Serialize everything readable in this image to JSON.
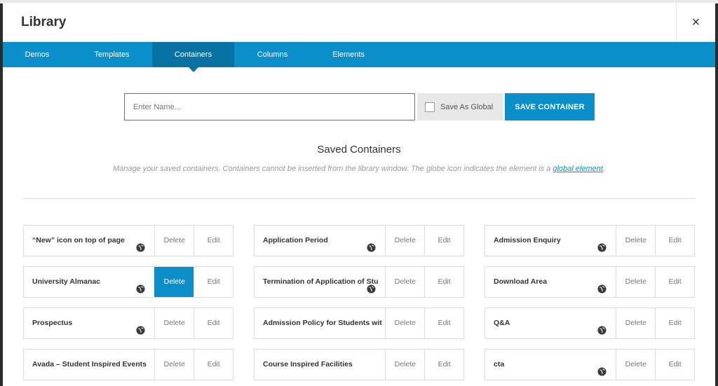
{
  "modal": {
    "title": "Library",
    "close_label": "×"
  },
  "tabs": [
    {
      "label": "Demos",
      "active": false
    },
    {
      "label": "Templates",
      "active": false
    },
    {
      "label": "Containers",
      "active": true
    },
    {
      "label": "Columns",
      "active": false
    },
    {
      "label": "Elements",
      "active": false
    }
  ],
  "save_form": {
    "name_placeholder": "Enter Name...",
    "name_value": "",
    "global_label": "Save As Global",
    "global_checked": false,
    "save_button": "SAVE CONTAINER"
  },
  "saved": {
    "title": "Saved Containers",
    "desc_before": "Manage your saved containers. Containers cannot be inserted from the library window. The globe icon indicates the element is a ",
    "desc_link": "global element",
    "desc_after": "."
  },
  "containers": [
    {
      "name": "“New” icon on top of page",
      "global": true,
      "delete": "Delete",
      "edit": "Edit"
    },
    {
      "name": "Application Period",
      "global": true,
      "delete": "Delete",
      "edit": "Edit"
    },
    {
      "name": "Admission Enquiry",
      "global": true,
      "delete": "Delete",
      "edit": "Edit"
    },
    {
      "name": "University Almanac",
      "global": true,
      "delete": "Delete",
      "edit": "Edit",
      "delete_hover": true
    },
    {
      "name": "Termination of Application of Stu",
      "global": true,
      "delete": "Delete",
      "edit": "Edit"
    },
    {
      "name": "Download Area",
      "global": true,
      "delete": "Delete",
      "edit": "Edit"
    },
    {
      "name": "Prospectus",
      "global": true,
      "delete": "Delete",
      "edit": "Edit"
    },
    {
      "name": "Admission Policy for Students wit",
      "global": false,
      "delete": "Delete",
      "edit": "Edit"
    },
    {
      "name": "Q&A",
      "global": true,
      "delete": "Delete",
      "edit": "Edit"
    },
    {
      "name": "Avada – Student Inspired Events",
      "global": false,
      "delete": "Delete",
      "edit": "Edit"
    },
    {
      "name": "Course Inspired Facilities",
      "global": false,
      "delete": "Delete",
      "edit": "Edit"
    },
    {
      "name": "cta",
      "global": true,
      "delete": "Delete",
      "edit": "Edit"
    }
  ],
  "colors": {
    "accent": "#0a8fca",
    "accent_dark": "#0873a3"
  }
}
